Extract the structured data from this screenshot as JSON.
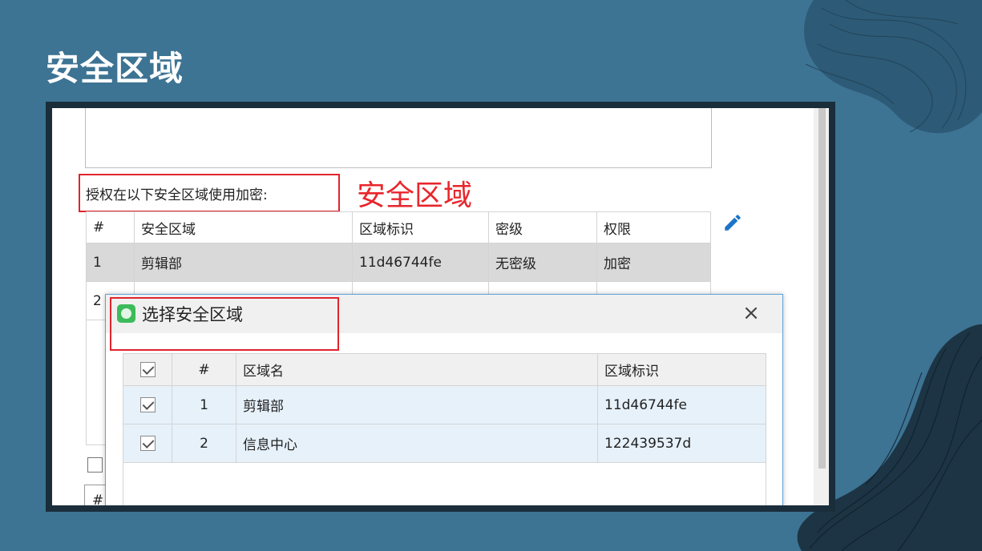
{
  "slide": {
    "title": "安全区域"
  },
  "annotation": {
    "text": "安全区域",
    "color": "#e8262c"
  },
  "panel": {
    "auth_label": "授权在以下安全区域使用加密:",
    "table": {
      "headers": [
        "#",
        "安全区域",
        "区域标识",
        "密级",
        "权限"
      ],
      "rows": [
        {
          "num": "1",
          "zone": "剪辑部",
          "id": "11d46744fe",
          "level": "无密级",
          "perm": "加密"
        },
        {
          "num": "2",
          "zone": "",
          "id": "",
          "level": "",
          "perm": ""
        }
      ]
    },
    "bottom_box_text": "#"
  },
  "dialog": {
    "title": "选择安全区域",
    "headers": {
      "num": "#",
      "name": "区域名",
      "id": "区域标识"
    },
    "rows": [
      {
        "num": "1",
        "name": "剪辑部",
        "id": "11d46744fe",
        "checked": true
      },
      {
        "num": "2",
        "name": "信息中心",
        "id": "122439537d",
        "checked": true
      }
    ]
  },
  "colors": {
    "background": "#3d7393",
    "frame": "#1a2d3b",
    "highlight": "#e0242d",
    "selected_row": "#e6f1fa",
    "accent_blue": "#1c74c9"
  },
  "icons": [
    "edit-pencil-icon",
    "app-icon",
    "close-icon",
    "checkbox-icon"
  ]
}
